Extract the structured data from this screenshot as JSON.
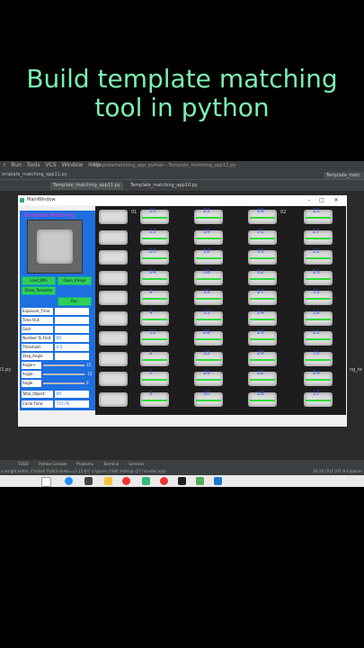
{
  "headline": {
    "line1": "Build template matching",
    "line2": "tool in python"
  },
  "ide": {
    "menu": [
      "r",
      "Run",
      "Tools",
      "VCS",
      "Window",
      "Help"
    ],
    "window_title": "Templatematching_app_python - Template_matching_app11.py",
    "project_file": "emplate_matching_app11.py",
    "editor_tabs": [
      "Template_matching_app11.py",
      "Template_matching_app10.py"
    ],
    "right_pane": "Template_matc",
    "left_code": "l1.py",
    "right_code": "ng_te",
    "status_tabs": [
      "TODO",
      "Python Console",
      "Problems",
      "Terminal",
      "Services"
    ],
    "status_message": "e insight better. // Install 'PyQt5-stubs==5.15.6.0' // Ignore // Edit settings (27 minutes ago)",
    "status_right": "33:19   CRLF   UTF-8   4 spaces"
  },
  "app": {
    "window_title": "MainWindow",
    "panel_title": "Template Matching",
    "buttons": {
      "load_img": "Load_IMG",
      "open_image": "Open_Image",
      "show_template": "Show_Template",
      "run": "Run"
    },
    "fields": [
      {
        "label": "Exposure_Time:",
        "value": ""
      },
      {
        "label": "Time Out:",
        "value": ""
      },
      {
        "label": "Gain:",
        "value": ""
      },
      {
        "label": "Number To Find:",
        "value": "65"
      },
      {
        "label": "Threshold:",
        "value": "0.5"
      },
      {
        "label": "Step_Angle",
        "value": ""
      }
    ],
    "sliders": [
      {
        "label": "Angle+",
        "value": "15"
      },
      {
        "label": "Angle-",
        "value": "-15"
      },
      {
        "label": "Angle",
        "value": "0"
      }
    ],
    "total_object": {
      "label": "Total_Object:",
      "value": "65"
    },
    "circle_time": {
      "label": "Circle Time:",
      "value": "757.76"
    }
  },
  "result_columns": [
    {
      "row_label": "01",
      "ids": [
        "",
        "",
        "",
        "",
        "",
        "",
        "",
        "",
        "",
        ""
      ]
    },
    {
      "row_label": "",
      "ids": [
        "25",
        "13",
        "20",
        "14",
        "9",
        "4",
        "12",
        "2",
        "3",
        "5"
      ]
    },
    {
      "row_label": "",
      "ids": [
        "23",
        "19",
        "16",
        "18",
        "15",
        "33",
        "28",
        "32",
        "29",
        "30"
      ]
    },
    {
      "row_label": "02",
      "ids": [
        "28",
        "31",
        "33",
        "32",
        "27",
        "24",
        "29",
        "29",
        "22",
        "28"
      ]
    },
    {
      "row_label": "",
      "ids": [
        "23",
        "27",
        "21",
        "25",
        "15",
        "19",
        "21",
        "15",
        "24",
        "17"
      ]
    }
  ],
  "colors": {
    "headline": "#7CF0B0",
    "panel": "#1e6fe0",
    "accent_green": "#2fcf56",
    "id_blue": "#3a5bff",
    "title_magenta": "#ff2fd2"
  }
}
